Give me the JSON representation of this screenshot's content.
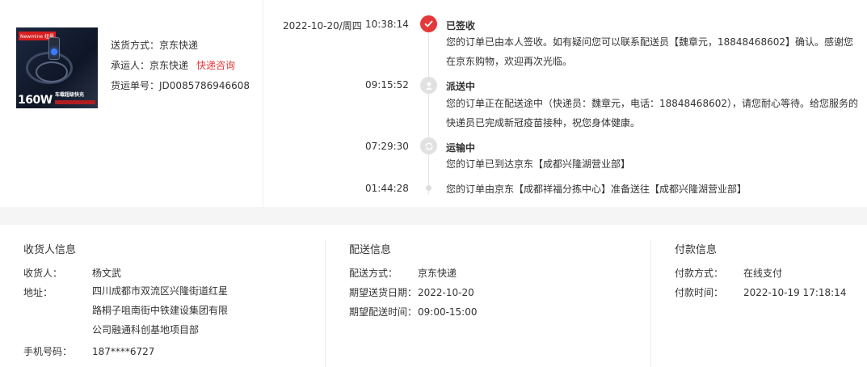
{
  "product": {
    "image_brand": "Newmine 纽曼",
    "image_power": "160W",
    "image_tagline": "车载超级快充"
  },
  "shipping": {
    "method_label": "送货方式：",
    "method_value": "京东快递",
    "carrier_label": "承运人：",
    "carrier_value": "京东快递",
    "carrier_link": "快递咨询",
    "tracking_label": "货运单号：",
    "tracking_value": "JD0085786946608"
  },
  "timeline": {
    "date": "2022-10-20/周四",
    "events": [
      {
        "time": "10:38:14",
        "title": "已签收",
        "desc": "您的订单已由本人签收。如有疑问您可以联系配送员【魏章元，18848468602】确认。感谢您在京东购物，欢迎再次光临。",
        "icon": "check-icon"
      },
      {
        "time": "09:15:52",
        "title": "派送中",
        "desc": "您的订单正在配送途中（快递员：魏章元，电话：18848468602），请您耐心等待。给您服务的快递员已完成新冠疫苗接种，祝您身体健康。",
        "icon": "courier-icon"
      },
      {
        "time": "07:29:30",
        "title": "运输中",
        "desc": "您的订单已到达京东【成都兴隆湖营业部】",
        "icon": "transit-icon"
      },
      {
        "time": "01:44:28",
        "title": "",
        "desc": "您的订单由京东【成都祥福分拣中心】准备送往【成都兴隆湖营业部】",
        "icon": "dot-icon"
      }
    ]
  },
  "receiver": {
    "title": "收货人信息",
    "name_label": "收货人：",
    "name_value": "杨文武",
    "address_label": "地址：",
    "address_value": "四川成都市双流区兴隆街道红星路桐子咀南街中铁建设集团有限公司融通科创基地项目部",
    "phone_label": "手机号码：",
    "phone_value": "187****6727"
  },
  "delivery": {
    "title": "配送信息",
    "method_label": "配送方式：",
    "method_value": "京东快递",
    "date_label": "期望送货日期：",
    "date_value": "2022-10-20",
    "time_label": "期望配送时间：",
    "time_value": "09:00-15:00"
  },
  "payment": {
    "title": "付款信息",
    "method_label": "付款方式：",
    "method_value": "在线支付",
    "time_label": "付款时间：",
    "time_value": "2022-10-19 17:18:14"
  },
  "colors": {
    "accent": "#e4393c",
    "divider": "#f5f5f5"
  }
}
